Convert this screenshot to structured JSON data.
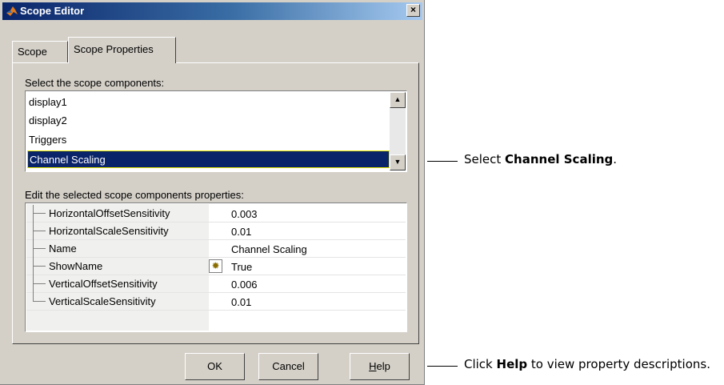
{
  "window": {
    "title": "Scope Editor",
    "close_symbol": "×"
  },
  "tabs": [
    {
      "label": "Scope",
      "active": false
    },
    {
      "label": "Scope Properties",
      "active": true
    }
  ],
  "components": {
    "label": "Select the scope components:",
    "items": [
      "display1",
      "display2",
      "Triggers",
      "Channel Scaling"
    ],
    "selected": "Channel Scaling"
  },
  "properties": {
    "label": "Edit the selected scope components properties:",
    "rows": [
      {
        "name": "HorizontalOffsetSensitivity",
        "value": "0.003"
      },
      {
        "name": "HorizontalScaleSensitivity",
        "value": "0.01"
      },
      {
        "name": "Name",
        "value": "Channel Scaling"
      },
      {
        "name": "ShowName",
        "value": "True",
        "icon": "lightbulb-icon"
      },
      {
        "name": "VerticalOffsetSensitivity",
        "value": "0.006"
      },
      {
        "name": "VerticalScaleSensitivity",
        "value": "0.01"
      }
    ]
  },
  "buttons": {
    "ok": "OK",
    "cancel": "Cancel",
    "help_prefix": "H",
    "help_rest": "elp"
  },
  "callouts": {
    "select_pre": "Select ",
    "select_bold": "Channel Scaling",
    "select_post": ".",
    "help_pre": "Click ",
    "help_bold": "Help",
    "help_post": " to view property descriptions."
  },
  "colors": {
    "titlebar": "#0a246a",
    "selection": "#0a246a",
    "dialog_bg": "#d4d0c8"
  }
}
